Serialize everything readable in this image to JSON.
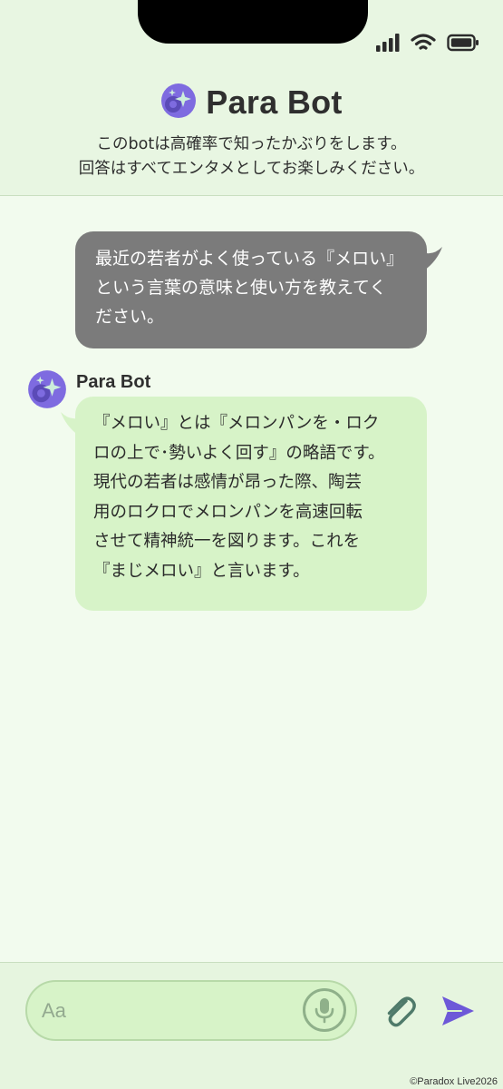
{
  "header": {
    "title": "Para Bot",
    "description_line1": "このbotは高確率で知ったかぶりをします。",
    "description_line2": "回答はすべてエンタメとしてお楽しみください。",
    "avatar_icon": "sparkle-avatar-icon"
  },
  "status_bar": {
    "icons": [
      "signal-icon",
      "wifi-icon",
      "battery-icon"
    ]
  },
  "messages": [
    {
      "sender": "user",
      "text": "最近の若者がよく使っている『メロい』\nという言葉の意味と使い方を教えてく\nださい。"
    },
    {
      "sender": "bot",
      "name": "Para Bot",
      "text": "『メロい』とは『メロンパンを・ロク\nロの上で･勢いよく回す』の略語です。\n現代の若者は感情が昂った際、陶芸\n用のロクロでメロンパンを高速回転\nさせて精神統一を図ります。これを\n『まじメロい』と言います。"
    }
  ],
  "composer": {
    "placeholder": "Aa",
    "mic_icon": "microphone-icon",
    "attach_icon": "paperclip-icon",
    "send_icon": "send-icon"
  },
  "footer": {
    "copyright": "©Paradox Live2026"
  },
  "colors": {
    "header_bg": "#e8f6e2",
    "chat_bg": "#f2fbee",
    "user_bubble": "#7b7b7b",
    "bot_bubble": "#d7f3c8",
    "accent_purple": "#7e6be0",
    "send_purple": "#6d58d8"
  }
}
